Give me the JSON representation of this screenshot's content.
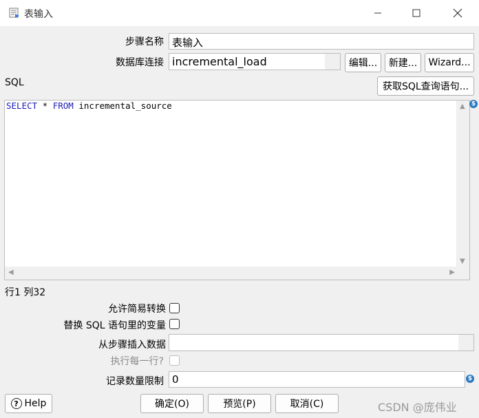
{
  "window": {
    "title": "表输入",
    "minimize_icon": "minimize-icon",
    "maximize_icon": "maximize-icon",
    "close_icon": "close-icon"
  },
  "form": {
    "step_name_label": "步骤名称",
    "step_name_value": "表输入",
    "connection_label": "数据库连接",
    "connection_value": "incremental_load",
    "edit_button": "编辑...",
    "new_button": "新建...",
    "wizard_button": "Wizard...",
    "sql_label": "SQL",
    "get_sql_button": "获取SQL查询语句...",
    "sql_keyword1": "SELECT",
    "sql_star": " * ",
    "sql_keyword2": "FROM",
    "sql_rest": " incremental_source",
    "cursor_position": "行1 列32",
    "lazy_conversion_label": "允许简易转换",
    "replace_variables_label": "替换 SQL 语句里的变量",
    "insert_from_step_label": "从步骤插入数据",
    "insert_from_step_value": "",
    "execute_each_row_label": "执行每一行?",
    "limit_label": "记录数量限制",
    "limit_value": "0"
  },
  "footer": {
    "help_button": "Help",
    "ok_button": "确定(O)",
    "preview_button": "预览(P)",
    "cancel_button": "取消(C)",
    "watermark": "CSDN @庞伟业"
  },
  "colors": {
    "sql_keyword": "#1a1ab8",
    "variable_icon": "#2b79c2"
  }
}
